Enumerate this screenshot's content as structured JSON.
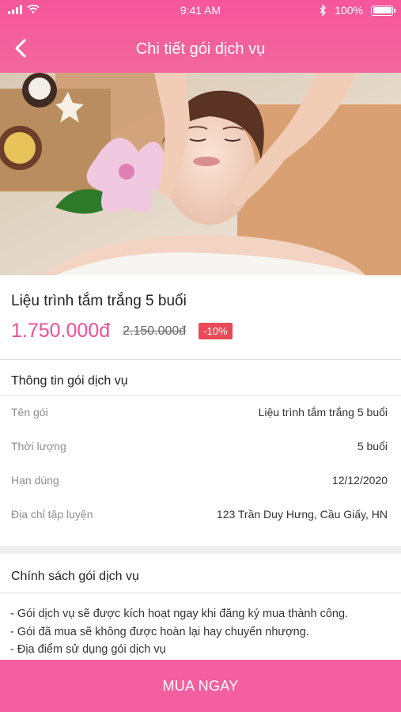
{
  "status": {
    "time": "9:41 AM",
    "battery": "100%",
    "battery_level": 1.0
  },
  "nav": {
    "title": "Chi tiết gói dịch vụ",
    "back_icon": "chevron-left-icon"
  },
  "product": {
    "name": "Liệu trình tắm trắng 5 buổi",
    "price": "1.750.000đ",
    "old_price": "2.150.000đ",
    "discount": "-10%"
  },
  "info": {
    "title": "Thông tin gói dịch vụ",
    "rows": [
      {
        "label": "Tên gói",
        "value": "Liệu trình tắm trắng 5 buổi"
      },
      {
        "label": "Thời lượng",
        "value": "5 buổi"
      },
      {
        "label": "Hạn dùng",
        "value": "12/12/2020"
      },
      {
        "label": "Địa chỉ tập luyện",
        "value": "123 Trần Duy Hưng, Cầu Giấy, HN"
      }
    ]
  },
  "policy": {
    "title": "Chính sách gói dịch vụ",
    "lines": [
      "- Gói dịch vụ sẽ được kích hoạt ngay khi đăng ký mua thành công.",
      "- Gói đã mua sẽ không được hoàn lại hay chuyển nhượng.",
      "- Địa điểm sử dụng gói dịch vụ"
    ]
  },
  "cta": {
    "label": "MUA NGAY"
  },
  "colors": {
    "brand": "#f45f9f",
    "price": "#ef4e97",
    "discount": "#e94a57"
  }
}
